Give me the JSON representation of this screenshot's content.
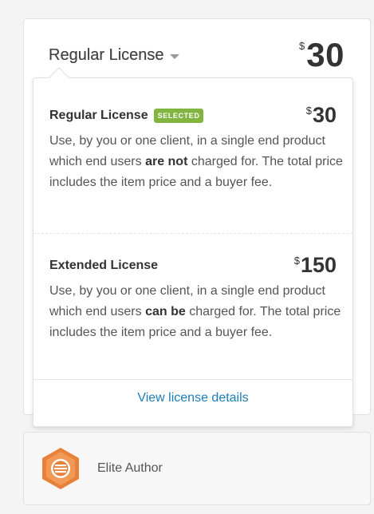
{
  "header": {
    "license_label": "Regular License",
    "currency": "$",
    "price": "30"
  },
  "dropdown": {
    "options": [
      {
        "title": "Regular License",
        "badge": "SELECTED",
        "currency": "$",
        "price": "30",
        "desc_pre": "Use, by you or one client, in a single end product which end users ",
        "desc_bold": "are not",
        "desc_post": " charged for. The total price includes the item price and a buyer fee."
      },
      {
        "title": "Extended License",
        "currency": "$",
        "price": "150",
        "desc_pre": "Use, by you or one client, in a single end product which end users ",
        "desc_bold": "can be",
        "desc_post": " charged for. The total price includes the item price and a buyer fee."
      }
    ],
    "details_link": "View license details"
  },
  "author": {
    "label": "Elite Author",
    "icon": "elite-author-badge-icon",
    "badge_color": "#e8803a"
  },
  "colors": {
    "selected_badge": "#82b440",
    "link": "#1b7db8"
  }
}
